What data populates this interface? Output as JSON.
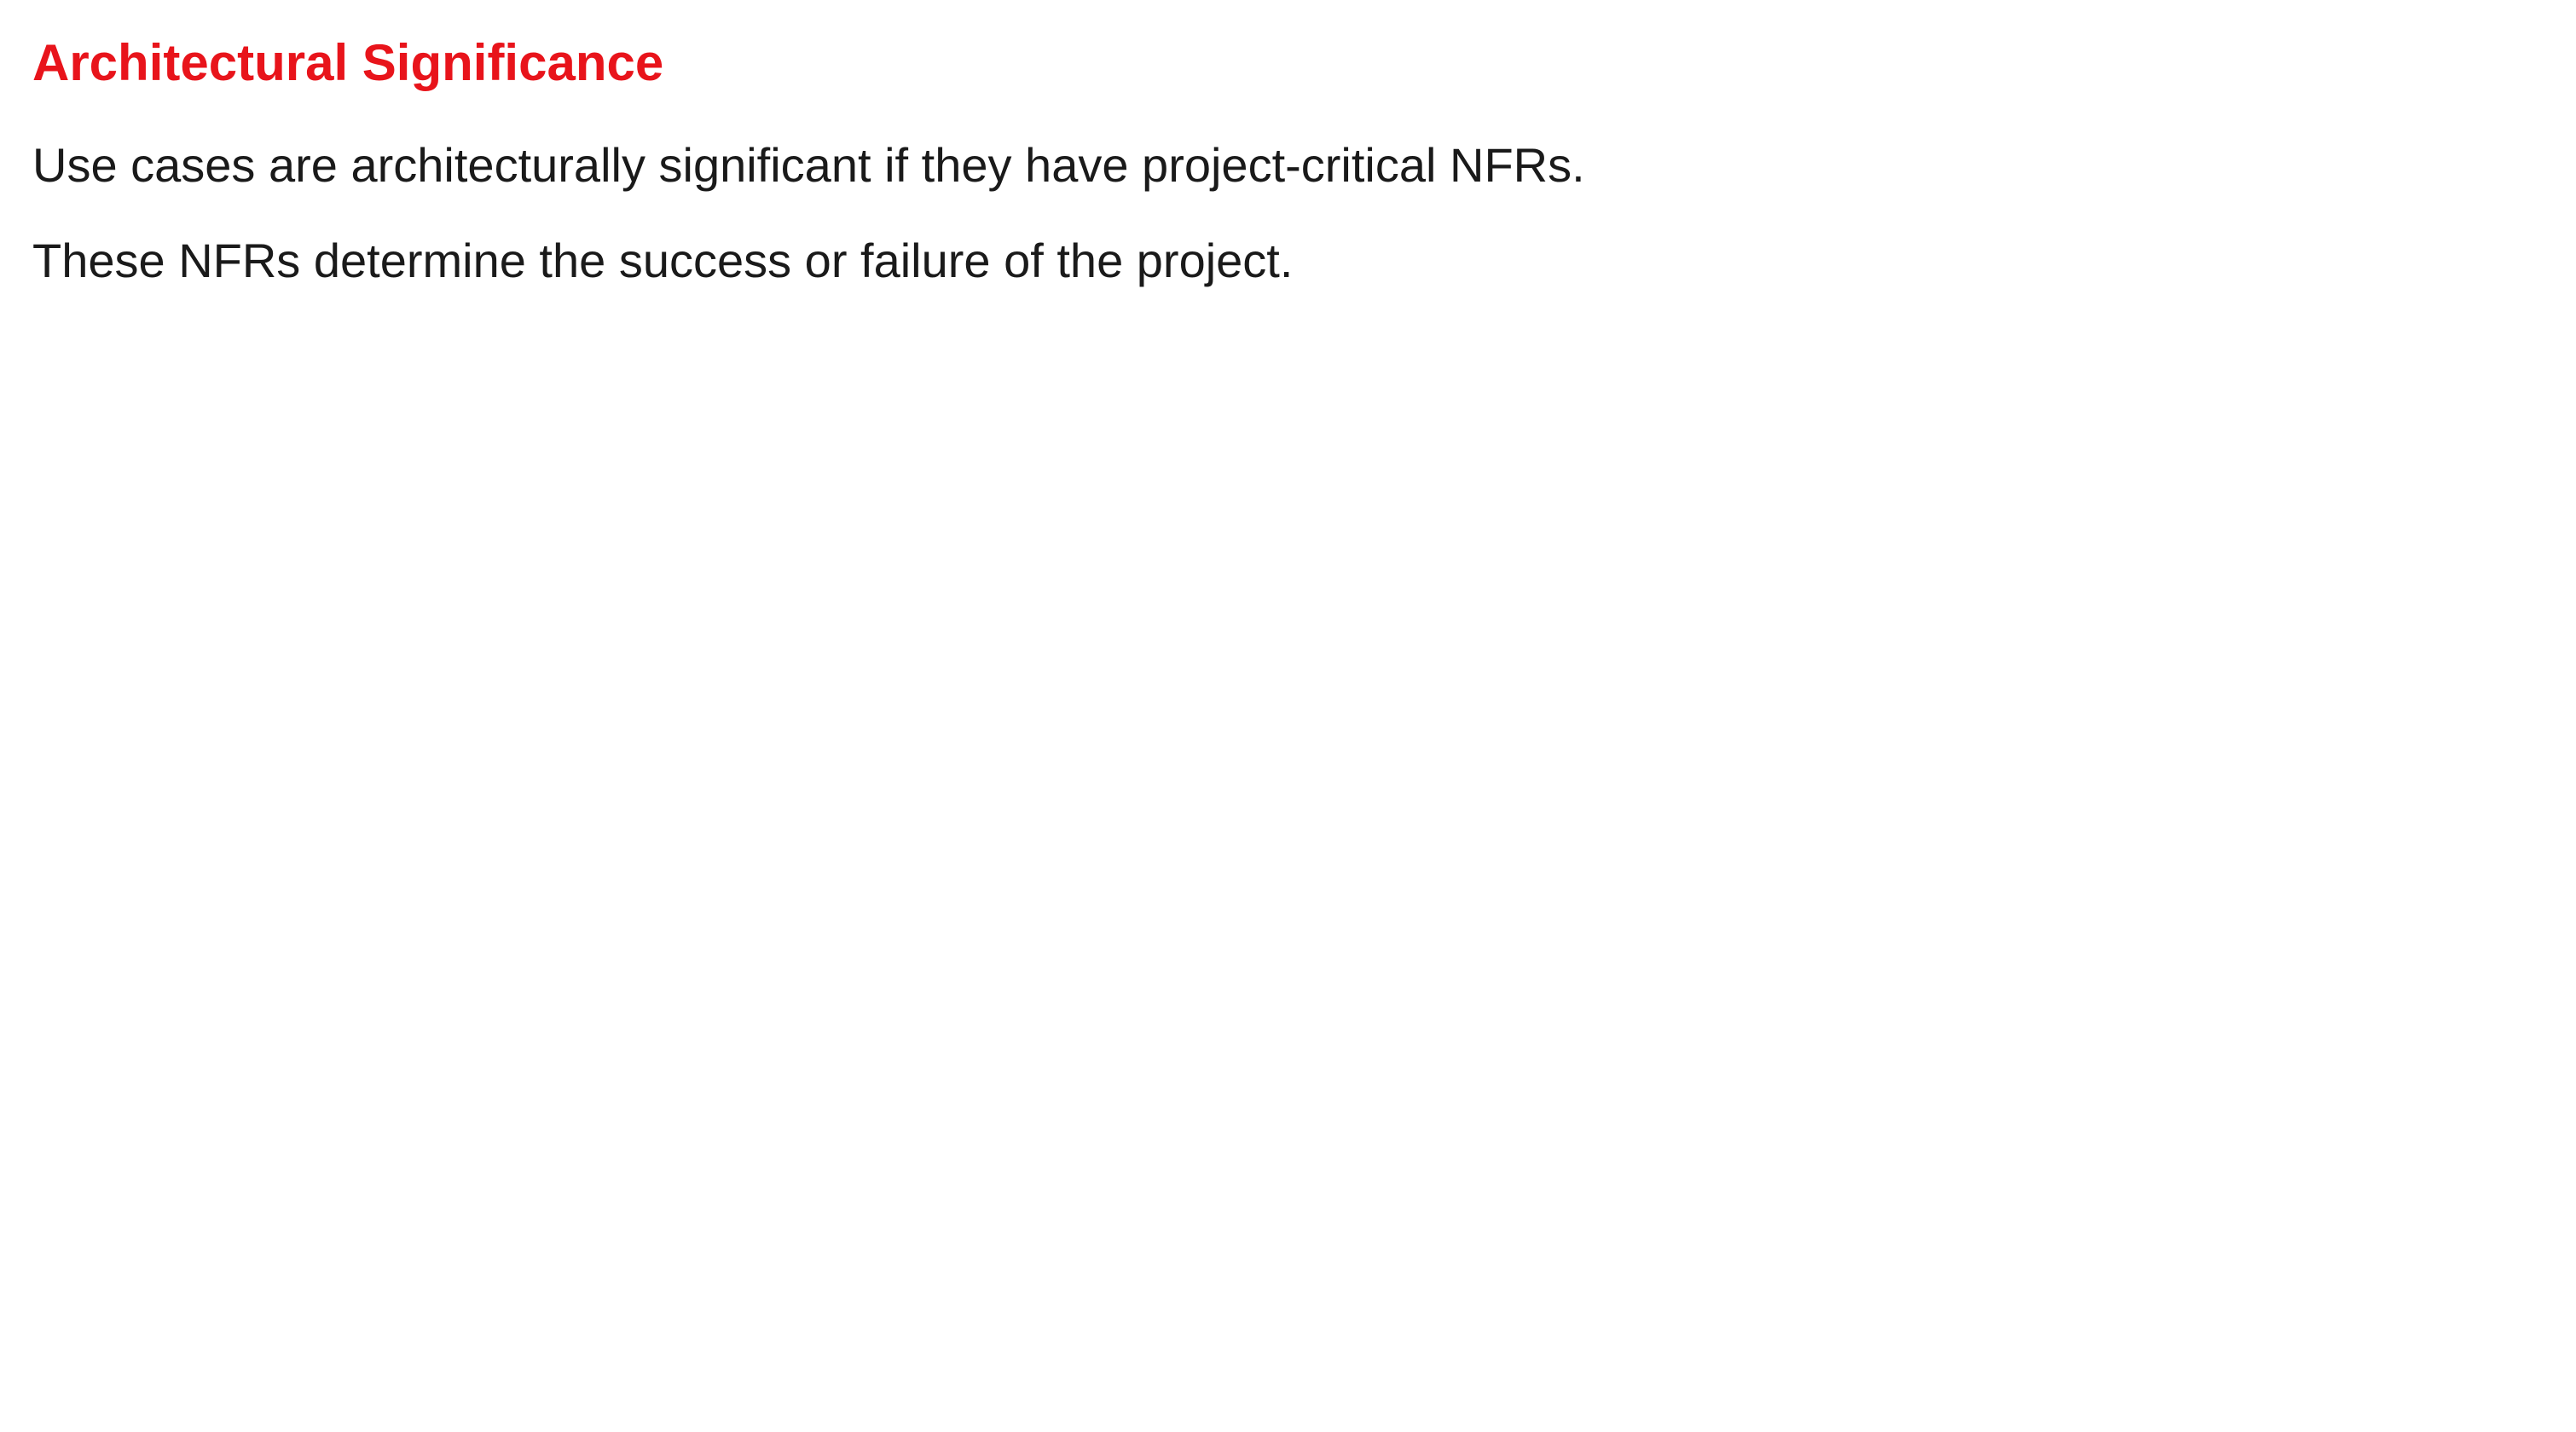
{
  "slide": {
    "title": "Architectural Significance",
    "lines": [
      "Use cases are architecturally significant if they have project-critical NFRs.",
      "These NFRs determine the success or failure of the project."
    ]
  },
  "colors": {
    "title": "#e8141b",
    "body": "#1a1a1a",
    "background": "#ffffff"
  }
}
